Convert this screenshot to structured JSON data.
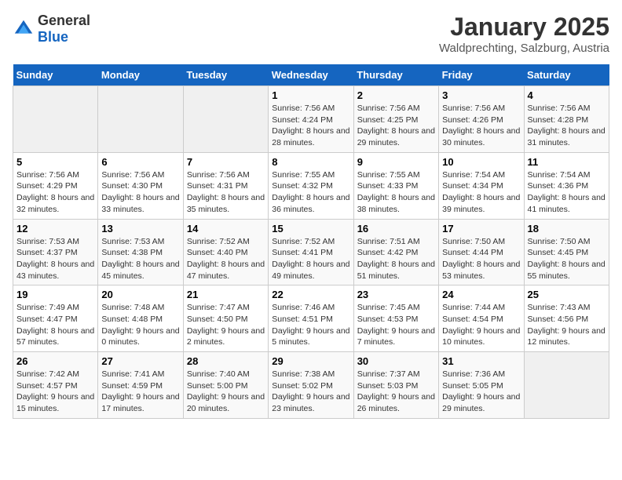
{
  "logo": {
    "general": "General",
    "blue": "Blue"
  },
  "title": "January 2025",
  "subtitle": "Waldprechting, Salzburg, Austria",
  "days_of_week": [
    "Sunday",
    "Monday",
    "Tuesday",
    "Wednesday",
    "Thursday",
    "Friday",
    "Saturday"
  ],
  "weeks": [
    [
      {
        "day": "",
        "empty": true
      },
      {
        "day": "",
        "empty": true
      },
      {
        "day": "",
        "empty": true
      },
      {
        "day": "1",
        "sunrise": "Sunrise: 7:56 AM",
        "sunset": "Sunset: 4:24 PM",
        "daylight": "Daylight: 8 hours and 28 minutes."
      },
      {
        "day": "2",
        "sunrise": "Sunrise: 7:56 AM",
        "sunset": "Sunset: 4:25 PM",
        "daylight": "Daylight: 8 hours and 29 minutes."
      },
      {
        "day": "3",
        "sunrise": "Sunrise: 7:56 AM",
        "sunset": "Sunset: 4:26 PM",
        "daylight": "Daylight: 8 hours and 30 minutes."
      },
      {
        "day": "4",
        "sunrise": "Sunrise: 7:56 AM",
        "sunset": "Sunset: 4:28 PM",
        "daylight": "Daylight: 8 hours and 31 minutes."
      }
    ],
    [
      {
        "day": "5",
        "sunrise": "Sunrise: 7:56 AM",
        "sunset": "Sunset: 4:29 PM",
        "daylight": "Daylight: 8 hours and 32 minutes."
      },
      {
        "day": "6",
        "sunrise": "Sunrise: 7:56 AM",
        "sunset": "Sunset: 4:30 PM",
        "daylight": "Daylight: 8 hours and 33 minutes."
      },
      {
        "day": "7",
        "sunrise": "Sunrise: 7:56 AM",
        "sunset": "Sunset: 4:31 PM",
        "daylight": "Daylight: 8 hours and 35 minutes."
      },
      {
        "day": "8",
        "sunrise": "Sunrise: 7:55 AM",
        "sunset": "Sunset: 4:32 PM",
        "daylight": "Daylight: 8 hours and 36 minutes."
      },
      {
        "day": "9",
        "sunrise": "Sunrise: 7:55 AM",
        "sunset": "Sunset: 4:33 PM",
        "daylight": "Daylight: 8 hours and 38 minutes."
      },
      {
        "day": "10",
        "sunrise": "Sunrise: 7:54 AM",
        "sunset": "Sunset: 4:34 PM",
        "daylight": "Daylight: 8 hours and 39 minutes."
      },
      {
        "day": "11",
        "sunrise": "Sunrise: 7:54 AM",
        "sunset": "Sunset: 4:36 PM",
        "daylight": "Daylight: 8 hours and 41 minutes."
      }
    ],
    [
      {
        "day": "12",
        "sunrise": "Sunrise: 7:53 AM",
        "sunset": "Sunset: 4:37 PM",
        "daylight": "Daylight: 8 hours and 43 minutes."
      },
      {
        "day": "13",
        "sunrise": "Sunrise: 7:53 AM",
        "sunset": "Sunset: 4:38 PM",
        "daylight": "Daylight: 8 hours and 45 minutes."
      },
      {
        "day": "14",
        "sunrise": "Sunrise: 7:52 AM",
        "sunset": "Sunset: 4:40 PM",
        "daylight": "Daylight: 8 hours and 47 minutes."
      },
      {
        "day": "15",
        "sunrise": "Sunrise: 7:52 AM",
        "sunset": "Sunset: 4:41 PM",
        "daylight": "Daylight: 8 hours and 49 minutes."
      },
      {
        "day": "16",
        "sunrise": "Sunrise: 7:51 AM",
        "sunset": "Sunset: 4:42 PM",
        "daylight": "Daylight: 8 hours and 51 minutes."
      },
      {
        "day": "17",
        "sunrise": "Sunrise: 7:50 AM",
        "sunset": "Sunset: 4:44 PM",
        "daylight": "Daylight: 8 hours and 53 minutes."
      },
      {
        "day": "18",
        "sunrise": "Sunrise: 7:50 AM",
        "sunset": "Sunset: 4:45 PM",
        "daylight": "Daylight: 8 hours and 55 minutes."
      }
    ],
    [
      {
        "day": "19",
        "sunrise": "Sunrise: 7:49 AM",
        "sunset": "Sunset: 4:47 PM",
        "daylight": "Daylight: 8 hours and 57 minutes."
      },
      {
        "day": "20",
        "sunrise": "Sunrise: 7:48 AM",
        "sunset": "Sunset: 4:48 PM",
        "daylight": "Daylight: 9 hours and 0 minutes."
      },
      {
        "day": "21",
        "sunrise": "Sunrise: 7:47 AM",
        "sunset": "Sunset: 4:50 PM",
        "daylight": "Daylight: 9 hours and 2 minutes."
      },
      {
        "day": "22",
        "sunrise": "Sunrise: 7:46 AM",
        "sunset": "Sunset: 4:51 PM",
        "daylight": "Daylight: 9 hours and 5 minutes."
      },
      {
        "day": "23",
        "sunrise": "Sunrise: 7:45 AM",
        "sunset": "Sunset: 4:53 PM",
        "daylight": "Daylight: 9 hours and 7 minutes."
      },
      {
        "day": "24",
        "sunrise": "Sunrise: 7:44 AM",
        "sunset": "Sunset: 4:54 PM",
        "daylight": "Daylight: 9 hours and 10 minutes."
      },
      {
        "day": "25",
        "sunrise": "Sunrise: 7:43 AM",
        "sunset": "Sunset: 4:56 PM",
        "daylight": "Daylight: 9 hours and 12 minutes."
      }
    ],
    [
      {
        "day": "26",
        "sunrise": "Sunrise: 7:42 AM",
        "sunset": "Sunset: 4:57 PM",
        "daylight": "Daylight: 9 hours and 15 minutes."
      },
      {
        "day": "27",
        "sunrise": "Sunrise: 7:41 AM",
        "sunset": "Sunset: 4:59 PM",
        "daylight": "Daylight: 9 hours and 17 minutes."
      },
      {
        "day": "28",
        "sunrise": "Sunrise: 7:40 AM",
        "sunset": "Sunset: 5:00 PM",
        "daylight": "Daylight: 9 hours and 20 minutes."
      },
      {
        "day": "29",
        "sunrise": "Sunrise: 7:38 AM",
        "sunset": "Sunset: 5:02 PM",
        "daylight": "Daylight: 9 hours and 23 minutes."
      },
      {
        "day": "30",
        "sunrise": "Sunrise: 7:37 AM",
        "sunset": "Sunset: 5:03 PM",
        "daylight": "Daylight: 9 hours and 26 minutes."
      },
      {
        "day": "31",
        "sunrise": "Sunrise: 7:36 AM",
        "sunset": "Sunset: 5:05 PM",
        "daylight": "Daylight: 9 hours and 29 minutes."
      },
      {
        "day": "",
        "empty": true
      }
    ]
  ]
}
